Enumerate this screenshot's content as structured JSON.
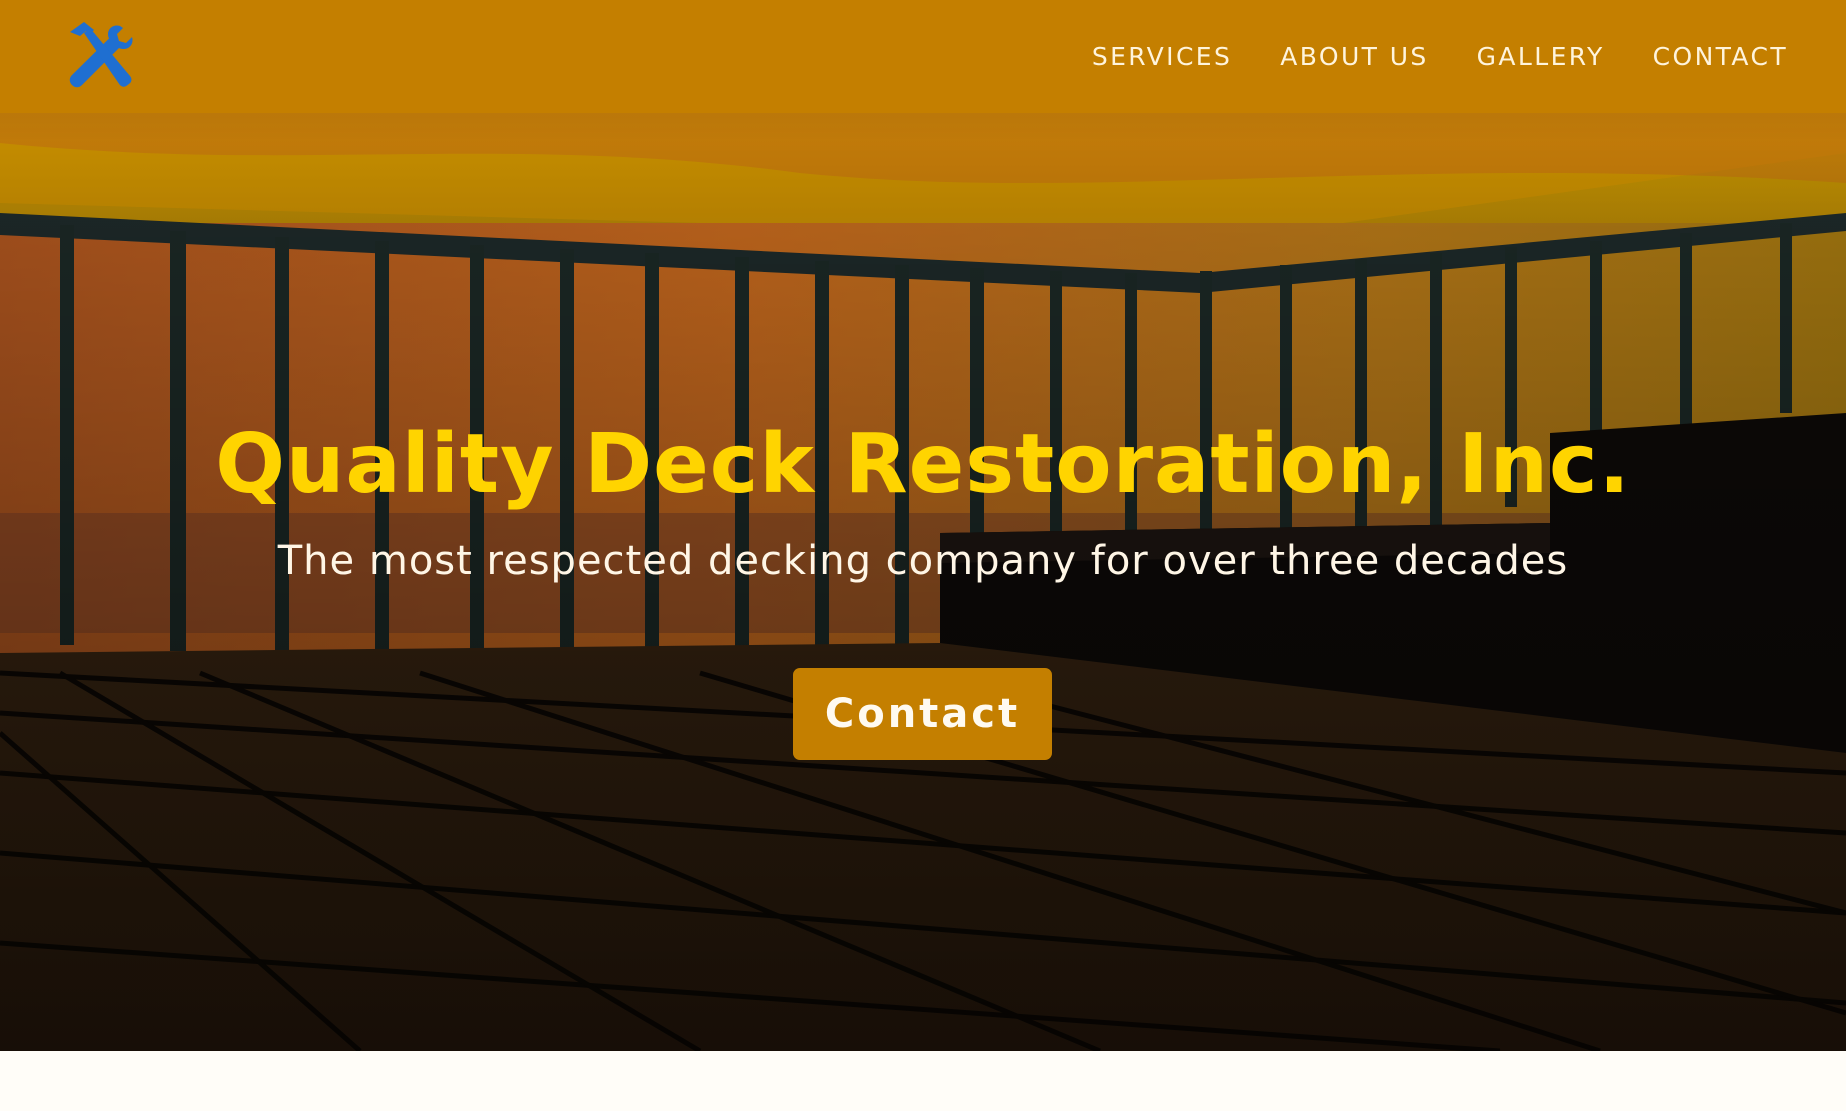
{
  "header": {
    "logo_icon": "hammer-wrench-icon",
    "background_color": "#c47f00",
    "logo_color": "#1f6fd1"
  },
  "nav": {
    "items": [
      {
        "label": "SERVICES"
      },
      {
        "label": "ABOUT US"
      },
      {
        "label": "GALLERY"
      },
      {
        "label": "CONTACT"
      }
    ]
  },
  "hero": {
    "title": "Quality Deck Restoration, Inc.",
    "subtitle": "The most respected decking company for over three decades",
    "cta_label": "Contact",
    "title_color": "#ffd400",
    "button_color": "#c47f00"
  }
}
